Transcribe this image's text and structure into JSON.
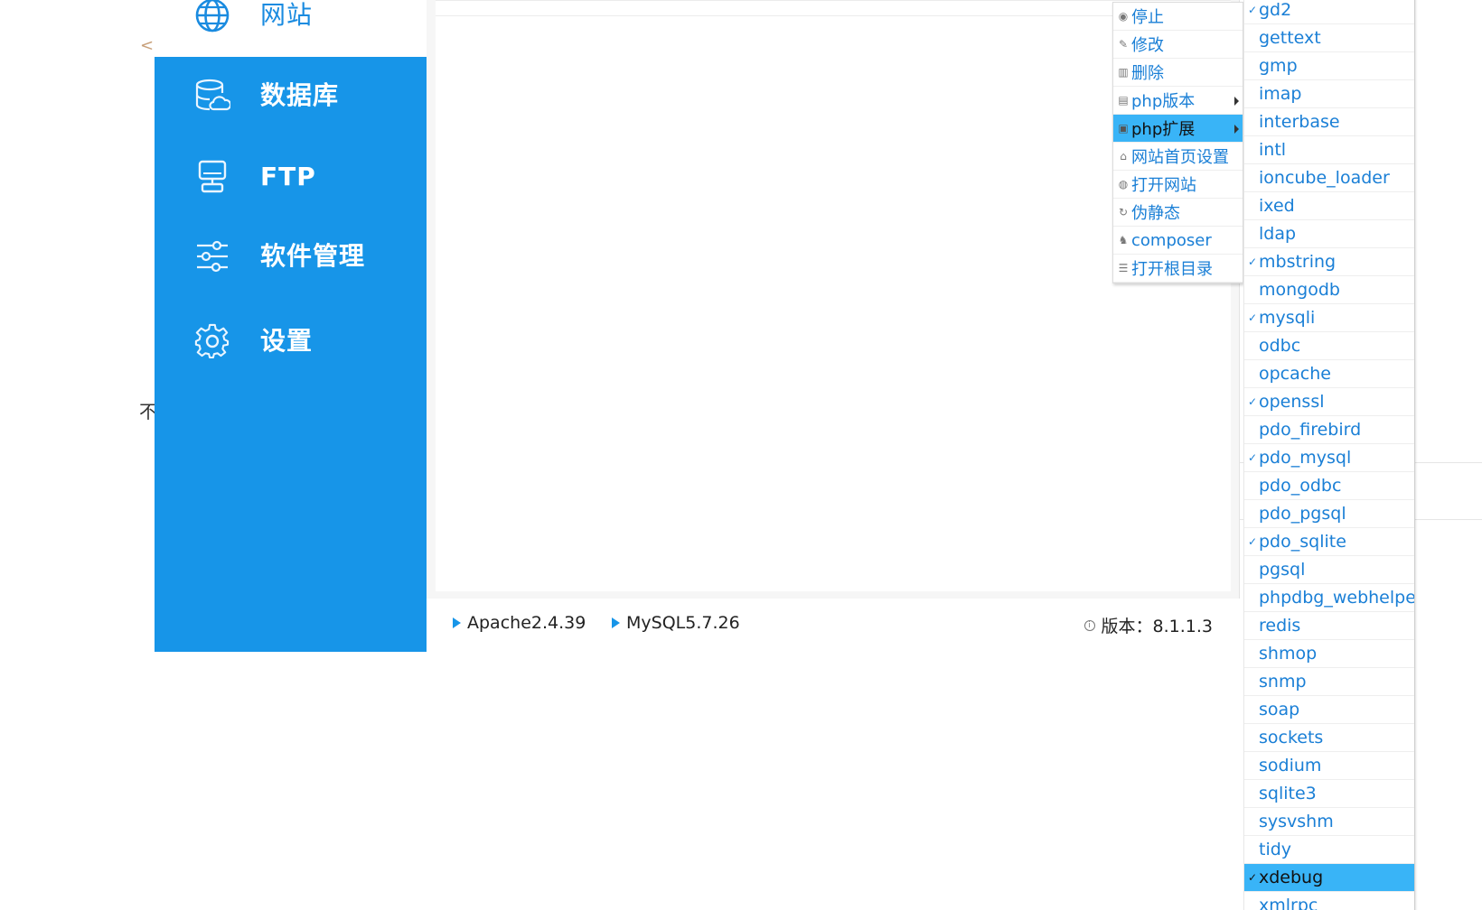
{
  "sidebar": {
    "items": [
      {
        "label": "网站",
        "icon": "globe-icon"
      },
      {
        "label": "数据库",
        "icon": "database-icon"
      },
      {
        "label": "FTP",
        "icon": "ftp-server-icon"
      },
      {
        "label": "软件管理",
        "icon": "sliders-icon"
      },
      {
        "label": "设置",
        "icon": "gear-icon"
      }
    ]
  },
  "status_bar": {
    "apache": "Apache2.4.39",
    "mysql": "MySQL5.7.26",
    "version": "版本：8.1.1.3"
  },
  "stray": {
    "lt": "<",
    "char": "不"
  },
  "context_menu": {
    "items": [
      {
        "label": "停止",
        "icon": "stop-icon"
      },
      {
        "label": "修改",
        "icon": "pencil-icon"
      },
      {
        "label": "删除",
        "icon": "trash-icon"
      },
      {
        "label": "php版本",
        "icon": "document-icon",
        "submenu": true
      },
      {
        "label": "php扩展",
        "icon": "extension-icon",
        "submenu": true,
        "active": true
      },
      {
        "label": "网站首页设置",
        "icon": "home-icon"
      },
      {
        "label": "打开网站",
        "icon": "globe-icon"
      },
      {
        "label": "伪静态",
        "icon": "refresh-icon"
      },
      {
        "label": "composer",
        "icon": "composer-icon"
      },
      {
        "label": "打开根目录",
        "icon": "list-icon"
      }
    ]
  },
  "extensions": {
    "items": [
      {
        "label": "gd2",
        "checked": true
      },
      {
        "label": "gettext",
        "checked": false
      },
      {
        "label": "gmp",
        "checked": false
      },
      {
        "label": "imap",
        "checked": false
      },
      {
        "label": "interbase",
        "checked": false
      },
      {
        "label": "intl",
        "checked": false
      },
      {
        "label": "ioncube_loader",
        "checked": false
      },
      {
        "label": "ixed",
        "checked": false
      },
      {
        "label": "ldap",
        "checked": false
      },
      {
        "label": "mbstring",
        "checked": true
      },
      {
        "label": "mongodb",
        "checked": false
      },
      {
        "label": "mysqli",
        "checked": true
      },
      {
        "label": "odbc",
        "checked": false
      },
      {
        "label": "opcache",
        "checked": false
      },
      {
        "label": "openssl",
        "checked": true
      },
      {
        "label": "pdo_firebird",
        "checked": false
      },
      {
        "label": "pdo_mysql",
        "checked": true
      },
      {
        "label": "pdo_odbc",
        "checked": false
      },
      {
        "label": "pdo_pgsql",
        "checked": false
      },
      {
        "label": "pdo_sqlite",
        "checked": true
      },
      {
        "label": "pgsql",
        "checked": false
      },
      {
        "label": "phpdbg_webhelper",
        "checked": false
      },
      {
        "label": "redis",
        "checked": false
      },
      {
        "label": "shmop",
        "checked": false
      },
      {
        "label": "snmp",
        "checked": false
      },
      {
        "label": "soap",
        "checked": false
      },
      {
        "label": "sockets",
        "checked": false
      },
      {
        "label": "sodium",
        "checked": false
      },
      {
        "label": "sqlite3",
        "checked": false
      },
      {
        "label": "sysvshm",
        "checked": false
      },
      {
        "label": "tidy",
        "checked": false
      },
      {
        "label": "xdebug",
        "checked": true,
        "active": true
      },
      {
        "label": "xmlrpc",
        "checked": false
      }
    ]
  },
  "colors": {
    "sidebar_blue": "#1795e8",
    "menu_link": "#1a7fd6",
    "menu_highlight": "#39b4f7"
  }
}
